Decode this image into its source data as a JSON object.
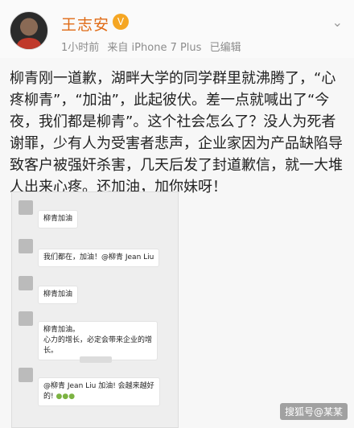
{
  "post": {
    "author": "王志安",
    "time": "1小时前",
    "source": "来自 iPhone 7 Plus",
    "edited": "已编辑",
    "body": "柳青刚一道歉，湖畔大学的同学群里就沸腾了，“心疼柳青”，“加油”，此起彼伏。差一点就喊出了“今夜，我们都是柳青”。这个社会怎么了？没人为死者谢罪，少有人为受害者悲声，企业家因为产品缺陷导致客户被强奸杀害，几天后发了封道歉信，就一大堆人出来心疼。还加油，加你妹呀！"
  },
  "chat": {
    "messages": [
      {
        "text": "柳青加油"
      },
      {
        "text": "我们都在，加油！@柳青 Jean Liu"
      },
      {
        "text": "柳青加油"
      },
      {
        "text": "柳青加油。"
      },
      {
        "text": "心力的增长，必定会带来企业的增"
      },
      {
        "text": "长。"
      },
      {
        "text": "@柳青 Jean Liu 加油! 会越来越好"
      },
      {
        "text": "的!"
      }
    ]
  },
  "watermark": "搜狐号@某某"
}
